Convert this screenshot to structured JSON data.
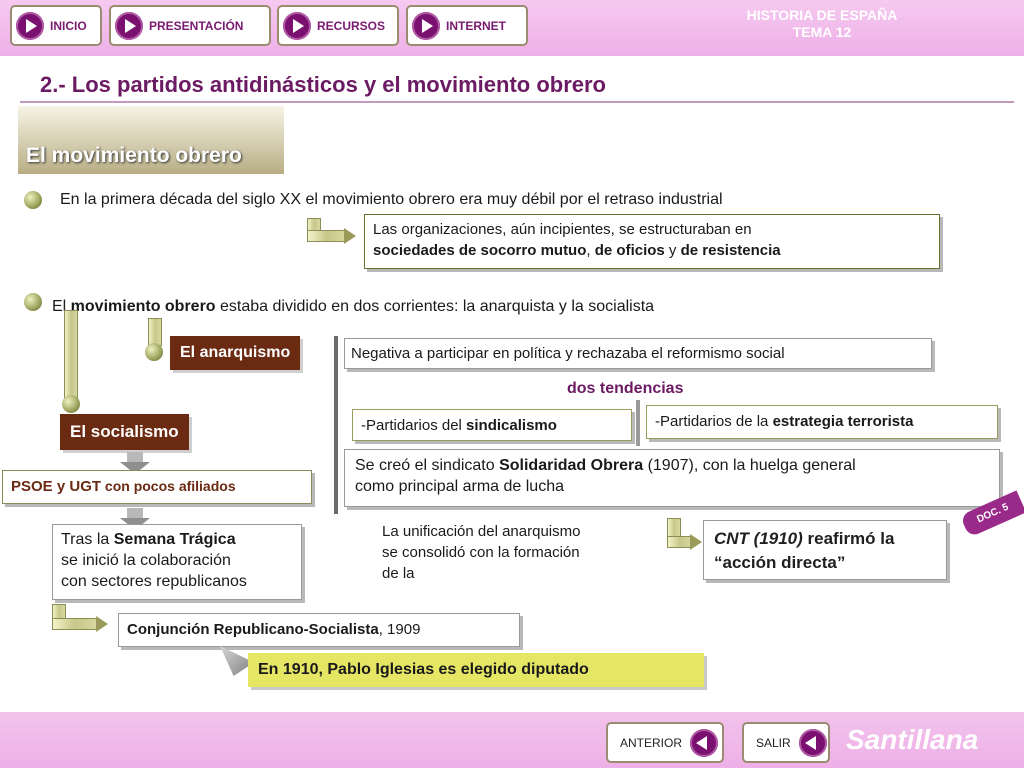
{
  "nav": {
    "inicio": "INICIO",
    "presentacion": "PRESENTACIÓN",
    "recursos": "RECURSOS",
    "internet": "INTERNET"
  },
  "header": {
    "line1": "HISTORIA DE ESPAÑA",
    "line2": "TEMA 12"
  },
  "title": "2.- Los partidos antidinásticos y el movimiento obrero",
  "section": "El movimiento obrero",
  "point1": "En la primera década del siglo XX el movimiento obrero era muy débil por el retraso industrial",
  "box1": {
    "a": "Las organizaciones, aún incipientes, se estructuraban en",
    "b1": "sociedades de socorro mutuo",
    "b2": ", ",
    "b3": "de oficios",
    "b4": " y ",
    "b5": "de resistencia"
  },
  "point2": {
    "a": "El ",
    "b": "movimiento obrero",
    "c": " estaba dividido en dos corrientes: la anarquista y la socialista"
  },
  "anarquismo": {
    "label": "El anarquismo",
    "desc": "Negativa a participar en política y rechazaba el reformismo social",
    "tendencias": "dos tendencias",
    "t1a": "-Partidarios del ",
    "t1b": "sindicalismo",
    "t2a": "-Partidarios de la ",
    "t2b": "estrategia terrorista",
    "so_a": "Se creó el sindicato ",
    "so_b": "Solidaridad Obrera",
    "so_c": " (1907), con la huelga general",
    "so_d": "como principal arma de lucha",
    "unif1": "La unificación del anarquismo",
    "unif2": "se consolidó con la formación",
    "unif3": "de la",
    "cnt_a": "CNT (1910)",
    "cnt_b": " reafirmó la",
    "cnt_c": "“acción directa”",
    "doc": "DOC. 5"
  },
  "socialismo": {
    "label": "El socialismo",
    "psoe_a": "PSOE y UGT",
    "psoe_b": " con pocos afiliados",
    "st1a": "Tras la ",
    "st1b": "Semana Trágica",
    "st2": "se inició la colaboración",
    "st3": "con sectores republicanos",
    "conj_a": "Conjunción Republicano-Socialista",
    "conj_b": ", 1909",
    "iglesias": "En 1910, Pablo Iglesias es elegido diputado"
  },
  "footer": {
    "anterior": "ANTERIOR",
    "salir": "SALIR",
    "brand": "Santillana"
  },
  "colors": {
    "accent": "#6b1a63",
    "topbar": "#eeb0e7",
    "brown": "#6b2a12",
    "olive": "#6b7030",
    "yellow": "#e6e665"
  }
}
